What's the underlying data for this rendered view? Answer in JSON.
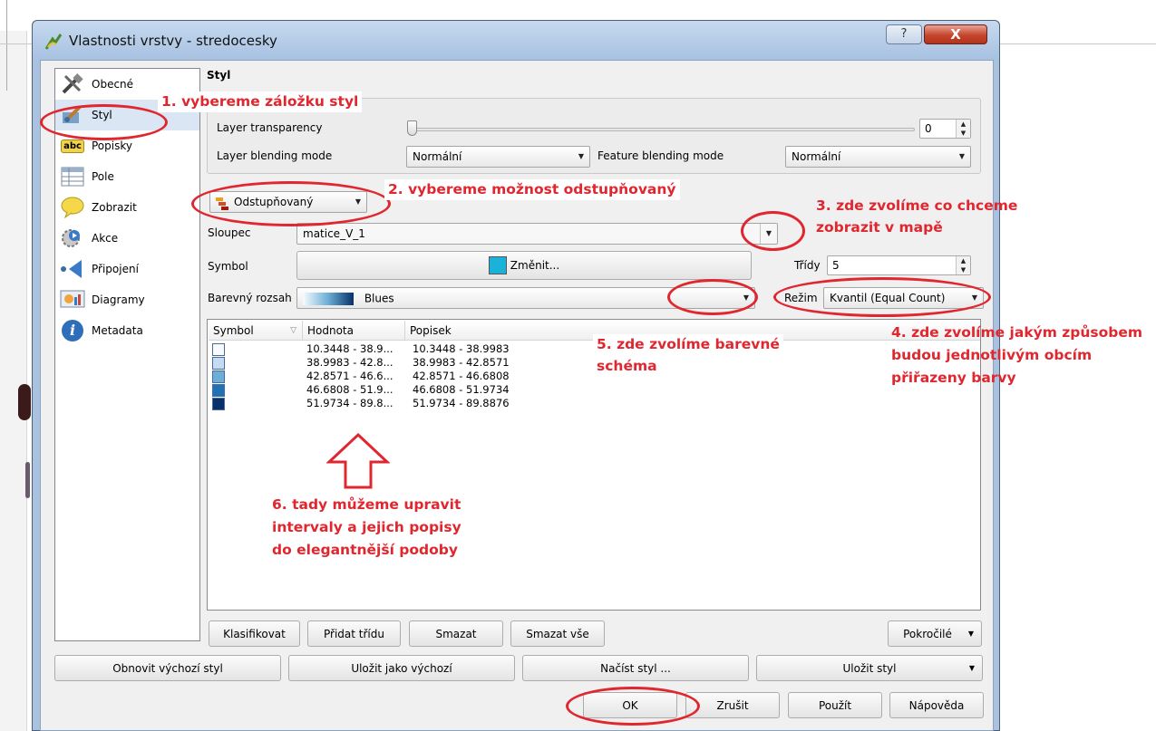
{
  "window": {
    "title": "Vlastnosti vrstvy - stredocesky",
    "help_label": "?",
    "close_label": "X"
  },
  "sidebar": {
    "items": [
      {
        "label": "Obecné",
        "icon": "tools-icon"
      },
      {
        "label": "Styl",
        "icon": "paintbrush-icon"
      },
      {
        "label": "Popisky",
        "icon": "abc-label-icon"
      },
      {
        "label": "Pole",
        "icon": "table-icon"
      },
      {
        "label": "Zobrazit",
        "icon": "speech-bubble-icon"
      },
      {
        "label": "Akce",
        "icon": "gear-play-icon"
      },
      {
        "label": "Připojení",
        "icon": "join-arrow-icon"
      },
      {
        "label": "Diagramy",
        "icon": "diagram-icon"
      },
      {
        "label": "Metadata",
        "icon": "info-icon"
      }
    ],
    "abc_text": "abc",
    "info_text": "i"
  },
  "style": {
    "section_title": "Styl",
    "layer_transparency_label": "Layer transparency",
    "transparency_value": "0",
    "layer_blending_label": "Layer blending mode",
    "layer_blending_value": "Normální",
    "feature_blending_label": "Feature blending mode",
    "feature_blending_value": "Normální",
    "renderer_value": "Odstupňovaný",
    "column_label": "Sloupec",
    "column_value": "matice_V_1",
    "symbol_label": "Symbol",
    "symbol_button": "Změnit...",
    "classes_label": "Třídy",
    "classes_value": "5",
    "ramp_label": "Barevný rozsah",
    "ramp_value": "Blues",
    "mode_label": "Režim",
    "mode_value": "Kvantil (Equal Count)"
  },
  "table": {
    "headers": [
      "Symbol",
      "Hodnota",
      "Popisek"
    ],
    "rows": [
      {
        "color": "#f7fbff",
        "value": "10.3448 - 38.9...",
        "label": "10.3448 - 38.9983"
      },
      {
        "color": "#c6dbef",
        "value": "38.9983 - 42.8...",
        "label": "38.9983 - 42.8571"
      },
      {
        "color": "#6baed6",
        "value": "42.8571 - 46.6...",
        "label": "42.8571 - 46.6808"
      },
      {
        "color": "#2171b5",
        "value": "46.6808 - 51.9...",
        "label": "46.6808 - 51.9734"
      },
      {
        "color": "#08306b",
        "value": "51.9734 - 89.8...",
        "label": "51.9734 - 89.8876"
      }
    ]
  },
  "class_buttons": {
    "classify": "Klasifikovat",
    "add_class": "Přidat třídu",
    "delete": "Smazat",
    "delete_all": "Smazat vše",
    "advanced": "Pokročilé"
  },
  "style_buttons": {
    "restore_default": "Obnovit výchozí styl",
    "save_default": "Uložit jako výchozí",
    "load_style": "Načíst styl ...",
    "save_style": "Uložit styl"
  },
  "dialog_buttons": {
    "ok": "OK",
    "cancel": "Zrušit",
    "apply": "Použít",
    "help": "Nápověda"
  },
  "annotations": {
    "a1": "1. vybereme záložku styl",
    "a2": "2. vybereme možnost odstupňovaný",
    "a3_line1": "3. zde zvolíme co chceme",
    "a3_line2": "zobrazit v mapě",
    "a4_line1": "4. zde zvolíme jakým způsobem",
    "a4_line2": "budou jednotlivým obcím",
    "a4_line3": "přiřazeny barvy",
    "a5_line1": "5. zde zvolíme barevné",
    "a5_line2": "schéma",
    "a6_line1": "6. tady můžeme upravit",
    "a6_line2": "intervaly a jejich popisy",
    "a6_line3": "do elegantnější podoby"
  },
  "colors": {
    "annotation": "#e0262f",
    "selected_item": "#dbe6f4",
    "title_bar": "#c6d9ef",
    "close_button": "#c4452b"
  }
}
